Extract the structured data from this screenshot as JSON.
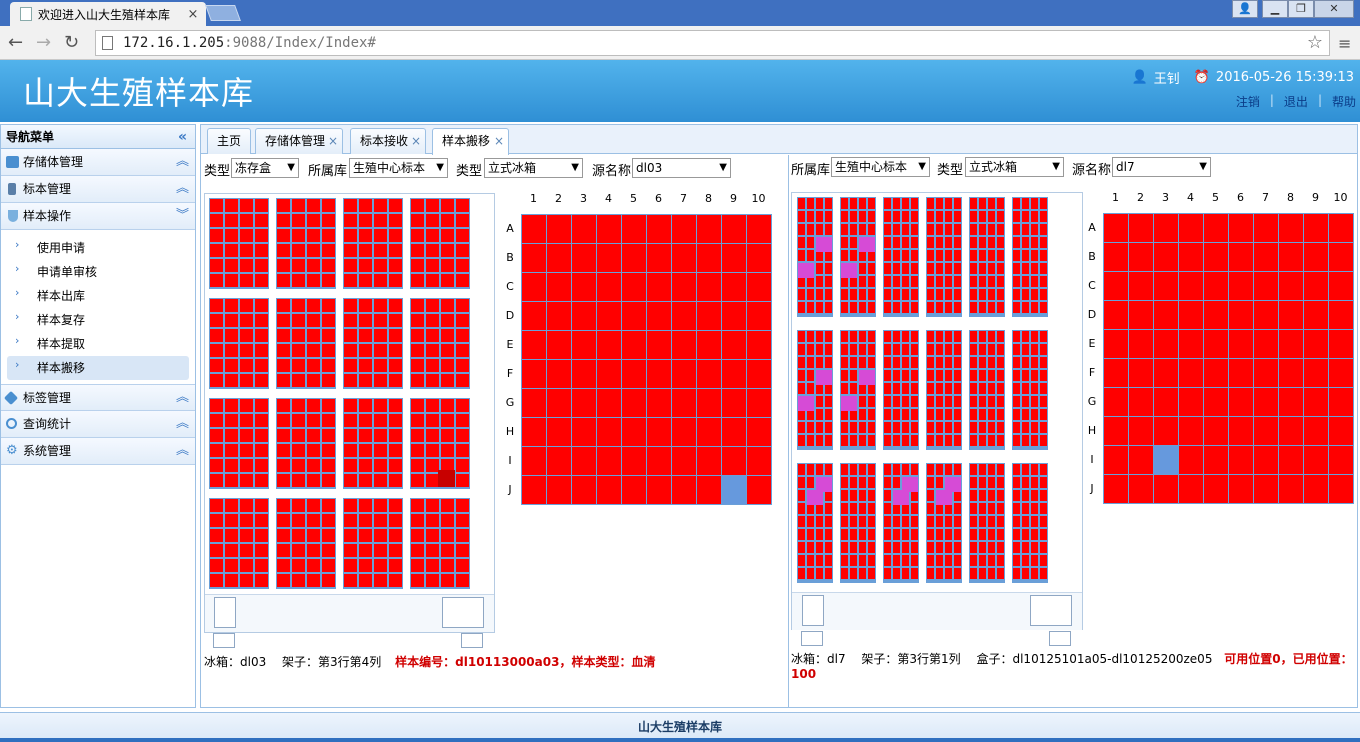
{
  "browser": {
    "tab_title": "欢迎进入山大生殖样本库",
    "address_host": "172.16.1.205",
    "address_path": ":9088/Index/Index#"
  },
  "header": {
    "title": "山大生殖样本库",
    "user": "王钊",
    "datetime": "2016-05-26 15:39:13",
    "links": [
      "注销",
      "退出",
      "帮助"
    ]
  },
  "sidebar": {
    "title": "导航菜单",
    "groups": [
      {
        "label": "存储体管理",
        "icon": "storage-icon"
      },
      {
        "label": "标本管理",
        "icon": "specimen-icon"
      },
      {
        "label": "样本操作",
        "icon": "flask-icon"
      }
    ],
    "subitems": [
      "使用申请",
      "申请单审核",
      "样本出库",
      "样本复存",
      "样本提取",
      "样本搬移"
    ],
    "groups_after": [
      {
        "label": "标签管理",
        "icon": "tag-icon"
      },
      {
        "label": "查询统计",
        "icon": "query-icon"
      },
      {
        "label": "系统管理",
        "icon": "gear-icon"
      }
    ]
  },
  "tabs": [
    {
      "label": "主页",
      "closable": false
    },
    {
      "label": "存储体管理",
      "closable": true
    },
    {
      "label": "标本接收",
      "closable": true
    },
    {
      "label": "样本搬移",
      "closable": true
    }
  ],
  "left_panel": {
    "type1_label": "类型",
    "type1_value": "冻存盒",
    "repo_label": "所属库",
    "repo_value": "生殖中心标本",
    "type2_label": "类型",
    "type2_value": "立式冰箱",
    "source_label": "源名称",
    "source_value": "dl03",
    "info_plain": "冰箱：dl03　 架子：第3行第4列",
    "info_red": "样本编号：dl10113000a03，样本类型：血清"
  },
  "right_panel": {
    "repo_label": "所属库",
    "repo_value": "生殖中心标本",
    "type_label": "类型",
    "type_value": "立式冰箱",
    "source_label": "源名称",
    "source_value": "dl7",
    "info_plain": "冰箱：dl7　 架子：第3行第1列　 盒子：dl10125101a05-dl10125200ze05",
    "info_red": "可用位置0，已用位置：100"
  },
  "grid": {
    "col_labels": [
      "1",
      "2",
      "3",
      "4",
      "5",
      "6",
      "7",
      "8",
      "9",
      "10"
    ],
    "row_labels": [
      "A",
      "B",
      "C",
      "D",
      "E",
      "F",
      "G",
      "H",
      "I",
      "J"
    ],
    "left_blue_cell": "J9",
    "right_blue_cell": "I3"
  },
  "colors": {
    "used": "#ff0000",
    "empty": "#6699dd",
    "grid_line": "#6a9fd8",
    "highlight": "#d64bd6"
  },
  "footer": {
    "text": "山大生殖样本库"
  }
}
